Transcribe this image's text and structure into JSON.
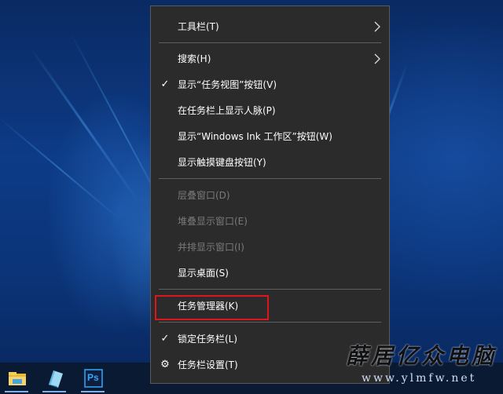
{
  "context_menu": {
    "items": [
      {
        "label": "工具栏(T)",
        "submenu": true
      },
      {
        "label": "搜索(H)",
        "submenu": true
      },
      {
        "label": "显示“任务视图”按钮(V)",
        "checked": true
      },
      {
        "label": "在任务栏上显示人脉(P)"
      },
      {
        "label": "显示“Windows Ink 工作区”按钮(W)"
      },
      {
        "label": "显示触摸键盘按钮(Y)"
      },
      {
        "label": "层叠窗口(D)",
        "disabled": true
      },
      {
        "label": "堆叠显示窗口(E)",
        "disabled": true
      },
      {
        "label": "并排显示窗口(I)",
        "disabled": true
      },
      {
        "label": "显示桌面(S)"
      },
      {
        "label": "任务管理器(K)",
        "highlighted": true
      },
      {
        "label": "锁定任务栏(L)",
        "checked": true
      },
      {
        "label": "任务栏设置(T)",
        "icon": "gear-icon"
      }
    ],
    "check_glyph": "✓",
    "arrow_glyph": "›",
    "gear_glyph": "⚙"
  },
  "taskbar": {
    "icons": [
      "file-explorer-icon",
      "app-icon",
      "photoshop-icon"
    ],
    "photoshop_label": "Ps"
  },
  "watermark": {
    "title": "薛居亿众电脑",
    "url": "www.ylmfw.net"
  },
  "colors": {
    "menu_bg": "#2b2b2b",
    "highlight_border": "#e0151c",
    "disabled_text": "#7a7a7a"
  }
}
